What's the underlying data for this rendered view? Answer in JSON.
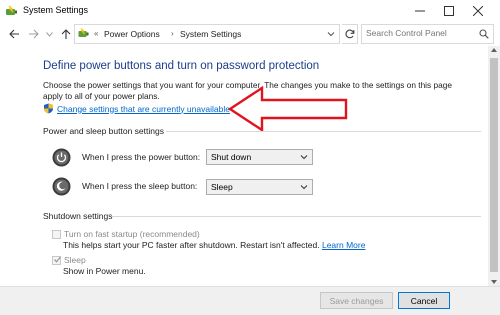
{
  "window": {
    "title": "System Settings",
    "icon": "power-options-icon"
  },
  "address_bar": {
    "overflow": "«",
    "crumbs": [
      "Power Options",
      "System Settings"
    ],
    "separator": "›",
    "search_placeholder": "Search Control Panel"
  },
  "content": {
    "heading": "Define power buttons and turn on password protection",
    "description": "Choose the power settings that you want for your computer. The changes you make to the settings on this page apply to all of your power plans.",
    "change_link": "Change settings that are currently unavailable",
    "power_section": {
      "title": "Power and sleep button settings",
      "power_button_label": "When I press the power button:",
      "power_button_value": "Shut down",
      "sleep_button_label": "When I press the sleep button:",
      "sleep_button_value": "Sleep"
    },
    "shutdown_section": {
      "title": "Shutdown settings",
      "fast_startup_label": "Turn on fast startup (recommended)",
      "fast_startup_desc": "This helps start your PC faster after shutdown. Restart isn't affected.",
      "learn_more": "Learn More",
      "fast_startup_checked": false,
      "sleep_label": "Sleep",
      "sleep_desc": "Show in Power menu.",
      "sleep_checked": true
    }
  },
  "footer": {
    "save_label": "Save changes",
    "cancel_label": "Cancel"
  },
  "colors": {
    "heading": "#1a3e8c",
    "link": "#0066cc",
    "annotation_arrow": "#e0141e"
  }
}
